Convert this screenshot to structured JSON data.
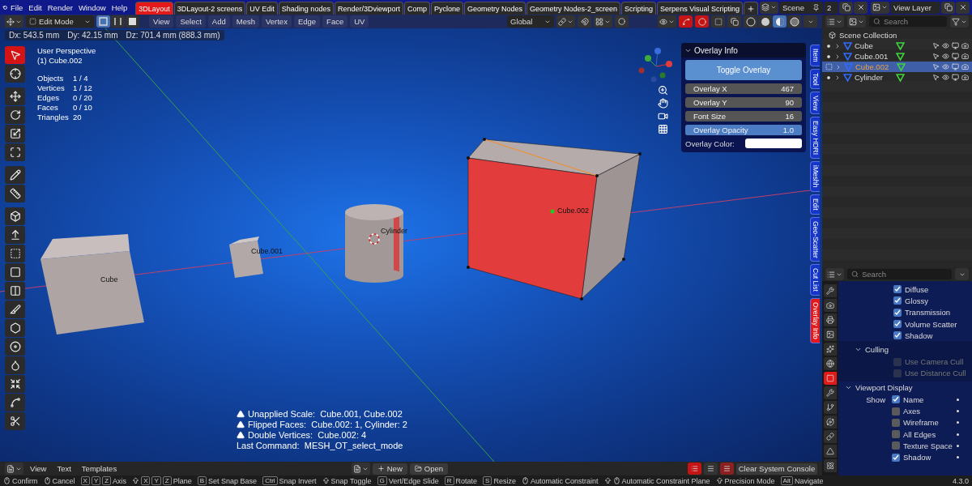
{
  "menu": [
    "File",
    "Edit",
    "Render",
    "Window",
    "Help"
  ],
  "workspace_tabs": [
    {
      "label": "3DLayout",
      "selected": true
    },
    {
      "label": "3DLayout-2 screens",
      "selected": false
    },
    {
      "label": "UV Edit",
      "selected": false
    },
    {
      "label": "Shading nodes",
      "selected": false
    },
    {
      "label": "Render/3Dviewport",
      "selected": false
    },
    {
      "label": "Comp",
      "selected": false
    },
    {
      "label": "Pyclone",
      "selected": false
    },
    {
      "label": "Geometry Nodes",
      "selected": false
    },
    {
      "label": "Geometry Nodes-2_screen",
      "selected": false
    },
    {
      "label": "Scripting",
      "selected": false
    },
    {
      "label": "Serpens Visual Scripting",
      "selected": false
    }
  ],
  "scene": {
    "name": "Scene",
    "users": "2"
  },
  "view_layer": {
    "name": "View Layer"
  },
  "viewport_header": {
    "mode": "Edit Mode",
    "select_modes": [
      {
        "kind": "vertex",
        "selected": true
      },
      {
        "kind": "edge",
        "selected": false
      },
      {
        "kind": "face",
        "selected": false
      }
    ],
    "menus": [
      "View",
      "Select",
      "Add",
      "Mesh",
      "Vertex",
      "Edge",
      "Face",
      "UV"
    ],
    "orientation": "Global",
    "shading": [
      {
        "kind": "wireframe",
        "selected": false
      },
      {
        "kind": "solid",
        "selected": false
      },
      {
        "kind": "material",
        "selected": true
      },
      {
        "kind": "rendered",
        "selected": false
      }
    ]
  },
  "measure": [
    "Dx: 543.5 mm",
    "Dy: 42.15 mm",
    "Dz: 701.4 mm (888.3 mm)"
  ],
  "viewport_info": {
    "view": "User Perspective",
    "object": "(1) Cube.002",
    "stats": [
      {
        "label": "Objects",
        "value": "1 / 4"
      },
      {
        "label": "Vertices",
        "value": "1 / 12"
      },
      {
        "label": "Edges",
        "value": "0 / 20"
      },
      {
        "label": "Faces",
        "value": "0 / 10"
      },
      {
        "label": "Triangles",
        "value": "20"
      }
    ]
  },
  "tools": [
    {
      "kind": "select",
      "selected": true
    },
    {
      "kind": "cursor",
      "selected": false
    },
    {
      "kind": "move",
      "selected": false
    },
    {
      "kind": "rotate",
      "selected": false
    },
    {
      "kind": "scale",
      "selected": false
    },
    {
      "kind": "transform",
      "selected": false
    },
    {
      "kind": "annotate",
      "selected": false
    },
    {
      "kind": "measure",
      "selected": false
    },
    {
      "kind": "add",
      "selected": false
    },
    {
      "kind": "extrude",
      "selected": false
    },
    {
      "kind": "inset",
      "selected": false
    },
    {
      "kind": "bevel",
      "selected": false
    },
    {
      "kind": "loopcut",
      "selected": false
    },
    {
      "kind": "knife",
      "selected": false
    },
    {
      "kind": "polybuild",
      "selected": false
    },
    {
      "kind": "spin",
      "selected": false
    },
    {
      "kind": "smooth",
      "selected": false
    },
    {
      "kind": "shrink",
      "selected": false
    },
    {
      "kind": "shear",
      "selected": false
    },
    {
      "kind": "rip",
      "selected": false
    }
  ],
  "objects": [
    {
      "label": "Cube"
    },
    {
      "label": "Cube.001"
    },
    {
      "label": "Cylinder"
    },
    {
      "label": "Cube.002"
    }
  ],
  "overlay_panel": {
    "title": "Overlay Info",
    "button": "Toggle Overlay",
    "fields": [
      {
        "kind": "number",
        "label": "Overlay X",
        "value": "467"
      },
      {
        "kind": "number",
        "label": "Overlay Y",
        "value": "90"
      },
      {
        "kind": "number",
        "label": "Font Size",
        "value": "16"
      },
      {
        "kind": "slider",
        "label": "Overlay Opacity",
        "value": "1.0",
        "level": 1
      }
    ],
    "color_label": "Overlay Color:",
    "color": "#ffffff"
  },
  "sidebar_tabs": [
    {
      "label": "Item",
      "selected": false
    },
    {
      "label": "Tool",
      "selected": false
    },
    {
      "label": "View",
      "selected": false
    },
    {
      "label": "Easy HDRI",
      "selected": false
    },
    {
      "label": "iMeshh",
      "selected": false
    },
    {
      "label": "Edit",
      "selected": false
    },
    {
      "label": "Geo-Scatter",
      "selected": false
    },
    {
      "label": "Cut List",
      "selected": false
    },
    {
      "label": "Overlay Info",
      "selected": true
    }
  ],
  "warnings": [
    {
      "kind": "warning",
      "text": "Unapplied Scale:  Cube.001, Cube.002"
    },
    {
      "kind": "warning",
      "text": "Flipped Faces:  Cube.002: 1, Cylinder: 2"
    },
    {
      "kind": "warning",
      "text": "Double Vertices:  Cube.002: 4"
    },
    {
      "kind": "info",
      "text": "Last Command:  MESH_OT_select_mode"
    }
  ],
  "outliner": {
    "search_placeholder": "Search",
    "collection": "Scene Collection",
    "items": [
      {
        "name": "Cube",
        "selected": false
      },
      {
        "name": "Cube.001",
        "selected": false
      },
      {
        "name": "Cube.002",
        "selected": true
      },
      {
        "name": "Cylinder",
        "selected": false
      }
    ]
  },
  "properties": {
    "search_placeholder": "Search",
    "tabs": [
      {
        "kind": "tool",
        "selected": false
      },
      {
        "kind": "render",
        "selected": false
      },
      {
        "kind": "output",
        "selected": false
      },
      {
        "kind": "view",
        "selected": false
      },
      {
        "kind": "scene",
        "selected": false
      },
      {
        "kind": "world",
        "selected": false
      },
      {
        "kind": "object",
        "selected": true
      },
      {
        "kind": "modifiers",
        "selected": false
      },
      {
        "kind": "particles",
        "selected": false
      },
      {
        "kind": "physics",
        "selected": false
      },
      {
        "kind": "constraints",
        "selected": false
      },
      {
        "kind": "data",
        "selected": false
      },
      {
        "kind": "material",
        "selected": false
      }
    ],
    "visibility": [
      {
        "label": "Diffuse",
        "checked": true
      },
      {
        "label": "Glossy",
        "checked": true
      },
      {
        "label": "Transmission",
        "checked": true
      },
      {
        "label": "Volume Scatter",
        "checked": true
      },
      {
        "label": "Shadow",
        "checked": true
      }
    ],
    "culling": {
      "title": "Culling",
      "items": [
        {
          "label": "Use Camera Cull",
          "checked": false,
          "disabled": true
        },
        {
          "label": "Use Distance Cull",
          "checked": false,
          "disabled": true
        }
      ]
    },
    "viewport_display": {
      "title": "Viewport Display",
      "show_label": "Show",
      "items": [
        {
          "label": "Name",
          "checked": true
        },
        {
          "label": "Axes",
          "checked": false
        },
        {
          "label": "Wireframe",
          "checked": false
        },
        {
          "label": "All Edges",
          "checked": false
        },
        {
          "label": "Texture Space",
          "checked": false
        },
        {
          "label": "Shadow",
          "checked": true
        }
      ]
    }
  },
  "text_editor": {
    "menus": [
      "View",
      "Text",
      "Templates"
    ],
    "new": "New",
    "open": "Open",
    "console": "Clear System Console"
  },
  "status_bar": {
    "hints": [
      {
        "kind": "mouse",
        "label": "Confirm"
      },
      {
        "kind": "mouse",
        "label": "Cancel"
      },
      {
        "kind": "keys",
        "keys": [
          "X",
          "Y",
          "Z"
        ],
        "label": "Axis"
      },
      {
        "kind": "shift_keys",
        "keys": [
          "X",
          "Y",
          "Z"
        ],
        "label": "Plane"
      },
      {
        "kind": "keys",
        "keys": [
          "B"
        ],
        "label": "Set Snap Base"
      },
      {
        "kind": "keys",
        "keys": [
          "Ctrl"
        ],
        "label": "Snap Invert"
      },
      {
        "kind": "shift",
        "label": "Snap Toggle"
      },
      {
        "kind": "keys",
        "keys": [
          "G"
        ],
        "label": "Vert/Edge Slide"
      },
      {
        "kind": "keys",
        "keys": [
          "R"
        ],
        "label": "Rotate"
      },
      {
        "kind": "keys",
        "keys": [
          "S"
        ],
        "label": "Resize"
      },
      {
        "kind": "mouse",
        "label": "Automatic Constraint"
      },
      {
        "kind": "shift_mouse",
        "label": "Automatic Constraint Plane"
      },
      {
        "kind": "shift",
        "label": "Precision Mode"
      },
      {
        "kind": "keys",
        "keys": [
          "Alt"
        ],
        "label": "Navigate"
      }
    ],
    "version": "4.3.0"
  }
}
